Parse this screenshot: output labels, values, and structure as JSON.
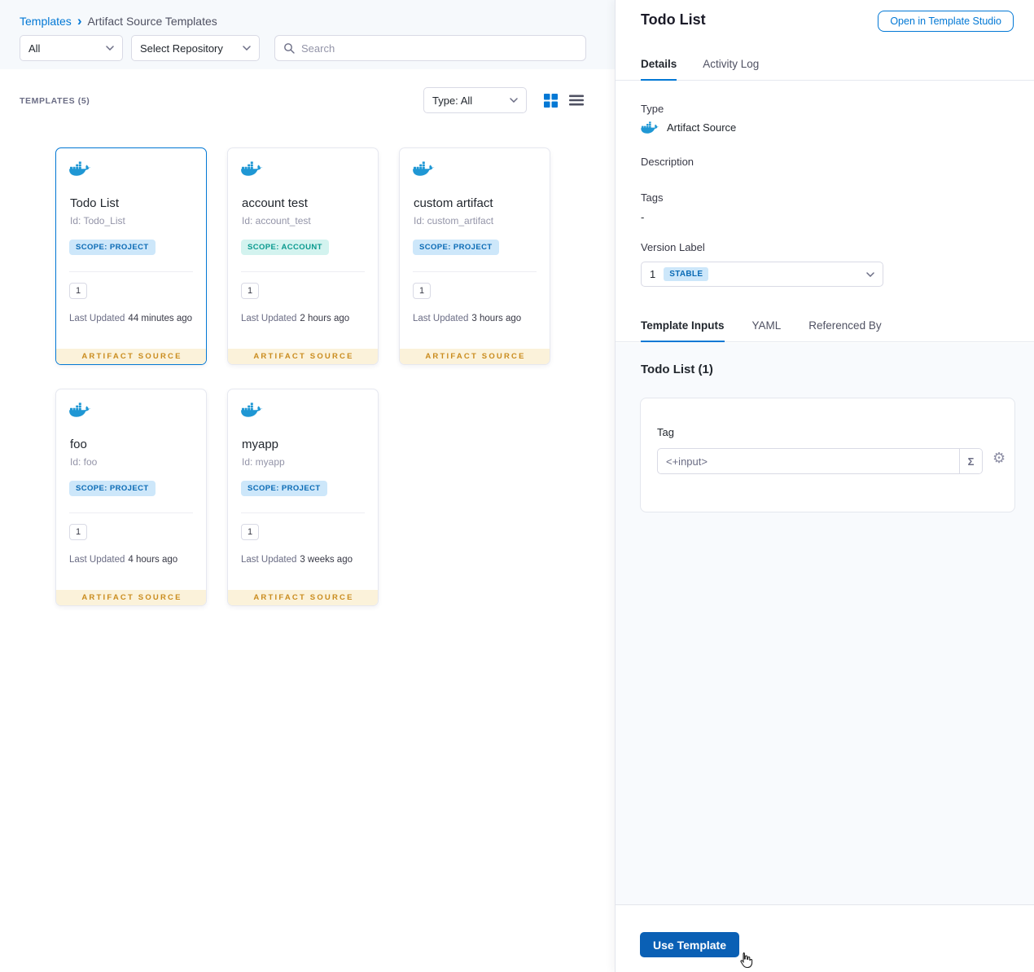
{
  "breadcrumb": {
    "templates": "Templates",
    "separator": "›",
    "current": "Artifact Source Templates"
  },
  "filters": {
    "scope": "All",
    "repository": "Select Repository",
    "search_placeholder": "Search"
  },
  "list_header": {
    "count": "TEMPLATES (5)",
    "type_filter": "Type: All"
  },
  "cards": [
    {
      "name": "Todo List",
      "id": "Id: Todo_List",
      "scope": "SCOPE: PROJECT",
      "version": "1",
      "updated_label": "Last Updated",
      "updated_value": "44 minutes ago",
      "ribbon": "ARTIFACT SOURCE"
    },
    {
      "name": "account test",
      "id": "Id: account_test",
      "scope": "SCOPE: ACCOUNT",
      "version": "1",
      "updated_label": "Last Updated",
      "updated_value": "2 hours ago",
      "ribbon": "ARTIFACT SOURCE"
    },
    {
      "name": "custom artifact",
      "id": "Id: custom_artifact",
      "scope": "SCOPE: PROJECT",
      "version": "1",
      "updated_label": "Last Updated",
      "updated_value": "3 hours ago",
      "ribbon": "ARTIFACT SOURCE"
    },
    {
      "name": "foo",
      "id": "Id: foo",
      "scope": "SCOPE: PROJECT",
      "version": "1",
      "updated_label": "Last Updated",
      "updated_value": "4 hours ago",
      "ribbon": "ARTIFACT SOURCE"
    },
    {
      "name": "myapp",
      "id": "Id: myapp",
      "scope": "SCOPE: PROJECT",
      "version": "1",
      "updated_label": "Last Updated",
      "updated_value": "3 weeks ago",
      "ribbon": "ARTIFACT SOURCE"
    }
  ],
  "panel": {
    "title": "Todo List",
    "open_studio_button": "Open in Template Studio",
    "tabs": [
      "Details",
      "Activity Log"
    ],
    "type_label": "Type",
    "type_value": "Artifact Source",
    "description_label": "Description",
    "tags_label": "Tags",
    "tags_value": "-",
    "version_label": "Version Label",
    "version_value": "1",
    "version_badge": "STABLE",
    "inner_tabs": [
      "Template Inputs",
      "YAML",
      "Referenced By"
    ],
    "inputs_title": "Todo List (1)",
    "tag_label": "Tag",
    "tag_value": "<+input>",
    "expression_icon": "Σ",
    "use_template_button": "Use Template"
  },
  "icons": {
    "gear": "⚙"
  },
  "colors": {
    "accent": "#0278d5",
    "primary_button": "#0a60b5",
    "docker_blue": "#1f97d4",
    "scope_project_bg": "#cde7fa",
    "scope_project_text": "#0b6bb5",
    "scope_account_bg": "#d3f3ef",
    "scope_account_text": "#0a9a8f",
    "ribbon_bg": "#fbf2da",
    "ribbon_text": "#ca8c1e",
    "stable_bg": "#cde7fa",
    "stable_text": "#0b6bb5"
  }
}
